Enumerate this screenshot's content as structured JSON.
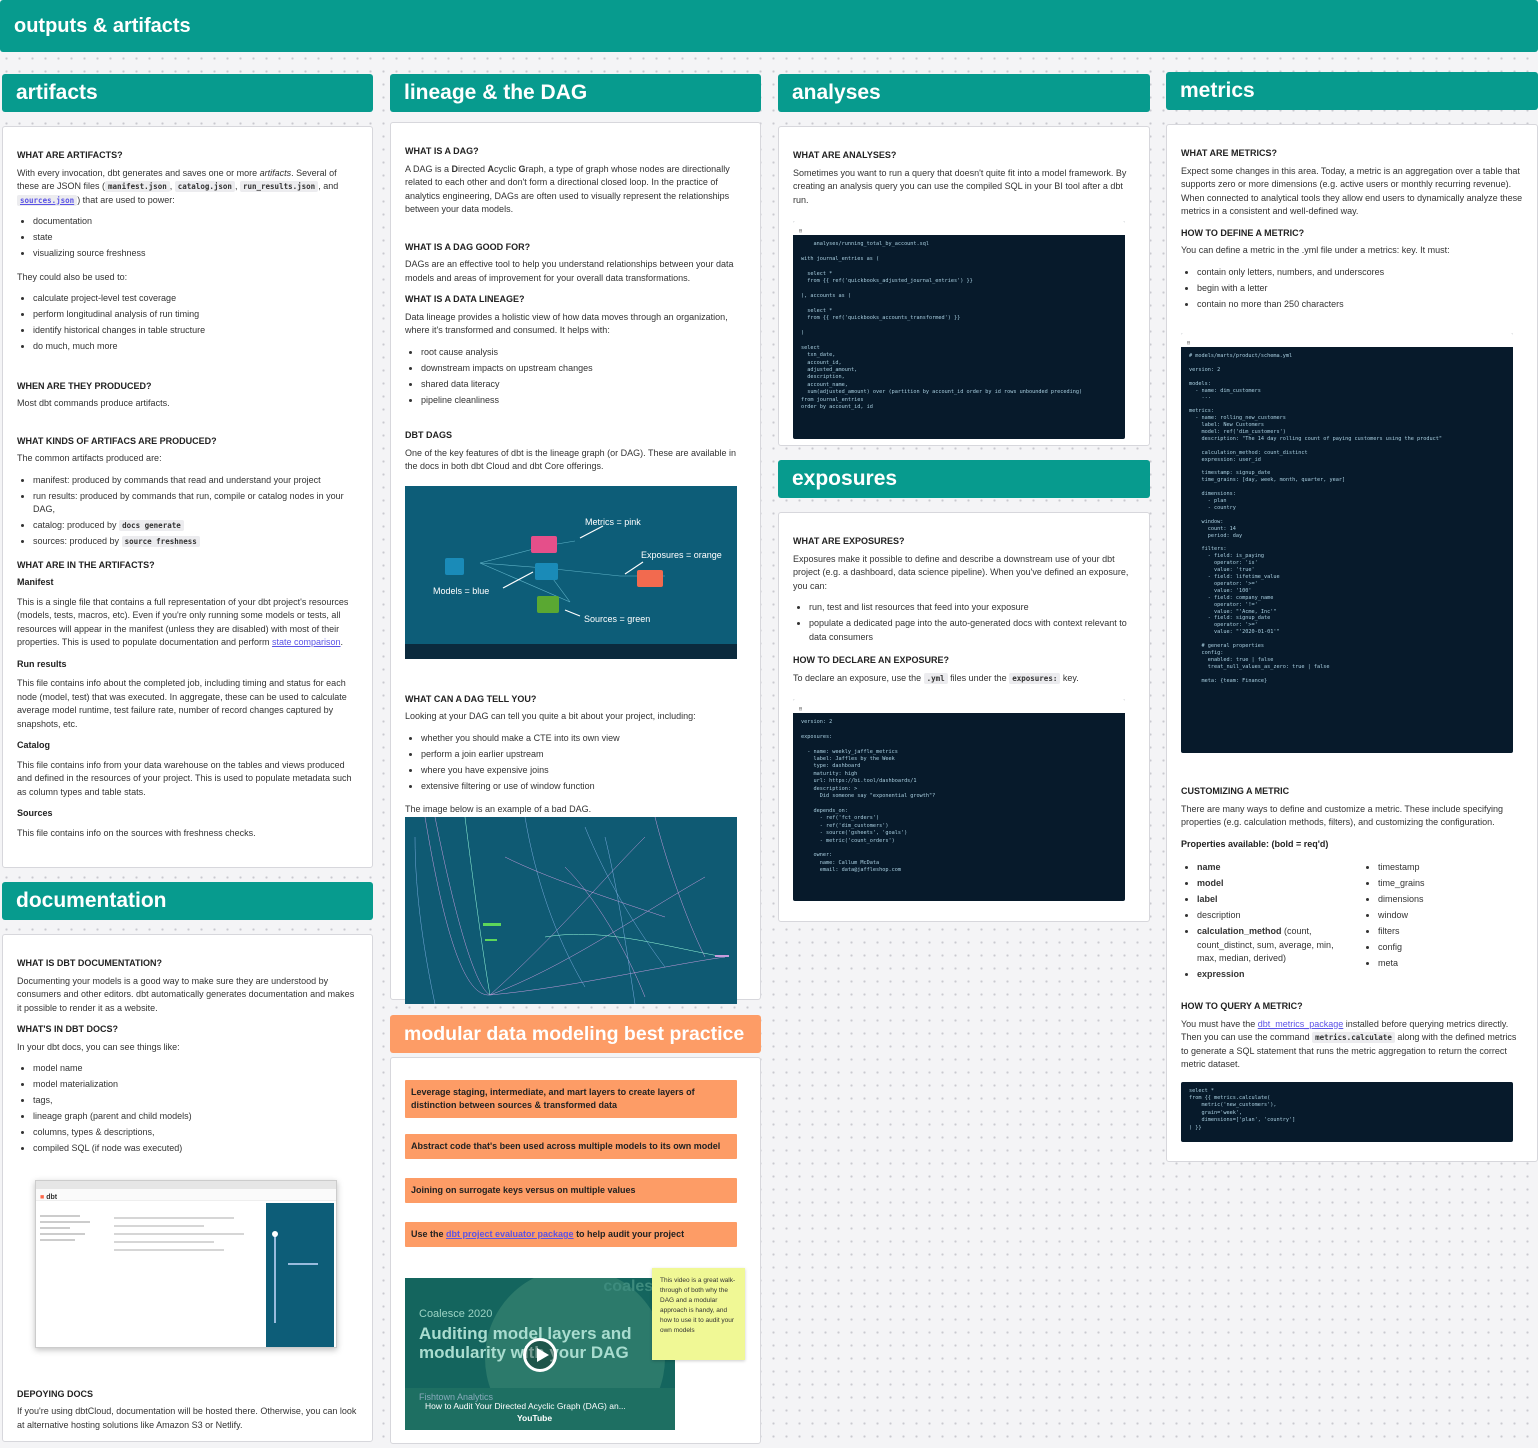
{
  "page": {
    "title": "outputs & artifacts"
  },
  "sections": {
    "artifacts": "artifacts",
    "lineage": "lineage & the DAG",
    "analyses": "analyses",
    "metrics": "metrics",
    "exposures": "exposures",
    "documentation": "documentation",
    "modular": "modular data modeling best practice"
  },
  "artifacts": {
    "q1": "WHAT ARE ARTIFACTS?",
    "p1_a": "With every invocation, dbt generates and saves one or more ",
    "p1_em": "artifacts",
    "p1_b": ". Several of these are JSON files (",
    "f1": "manifest.json",
    "f2": "catalog.json",
    "f3": "run_results.json",
    "f4": "sources.json",
    "p1_and": ", and ",
    "p1_c": ") that are used to power:",
    "sep": ", ",
    "list1": [
      "documentation",
      "state",
      "visualizing source freshness"
    ],
    "p2": "They could also be used to:",
    "list2": [
      "calculate project-level test coverage",
      "perform longitudinal analysis of run timing",
      "identify historical changes in table structure",
      "do much, much more"
    ],
    "q2": "WHEN ARE THEY PRODUCED?",
    "p3": "Most dbt commands produce artifacts.",
    "q3": "WHAT KINDS OF ARTIFACS ARE PRODUCED?",
    "p4": "The common artifacts produced are:",
    "k1": "manifest: produced by commands that read and understand your project",
    "k2": "run results: produced by commands that run, compile or catalog nodes in your DAG,",
    "k3a": "catalog: produced by ",
    "k3c": "docs generate",
    "k4a": "sources: produced by ",
    "k4c": "source freshness",
    "q4": "WHAT ARE IN THE ARTIFACTS?",
    "manifest_h": "Manifest",
    "manifest_p_a": "This is a single file that contains a full representation of your dbt project's resources (models, tests, macros, etc). Even if you're only running some models or tests, all resources will appear in the manifest (unless they are disabled) with most of their properties. This is used to populate documentation and perform ",
    "manifest_link": "state comparison",
    "manifest_p_b": ".",
    "run_h": "Run results",
    "run_p": "This file contains info about the completed job, including timing and status for each node (model, test) that was executed. In aggregate, these can be used to calculate average model runtime, test failure rate, number of record changes captured by snapshots, etc.",
    "catalog_h": "Catalog",
    "catalog_p": "This file contains info from your data warehouse on the tables and views produced and defined in the resources of your project. This is used to populate metadata such as column types and table stats.",
    "sources_h": "Sources",
    "sources_p": "This file contains info on the sources with freshness checks."
  },
  "documentation": {
    "q1": "WHAT IS DBT DOCUMENTATION?",
    "p1": "Documenting your models is a good way to make sure they are understood by consumers and other editors. dbt automatically generates documentation and makes it possible to render it as a website.",
    "q2": "WHAT'S IN DBT DOCS?",
    "p2": "In your dbt docs, you can see things like:",
    "list": [
      "model name",
      "model materialization",
      "tags,",
      "lineage graph (parent and child models)",
      "columns, types & descriptions,",
      "compiled SQL (if node was executed)"
    ],
    "logo": "dbt",
    "q3": "DEPOYING DOCS",
    "p3": "If you're using dbtCloud, documentation will be hosted there. Otherwise, you can look at alternative hosting solutions like Amazon S3 or Netlify."
  },
  "lineage": {
    "q1": "WHAT IS A DAG?",
    "p1_a": "A DAG is a ",
    "p1_D": "D",
    "p1_b": "irected ",
    "p1_A": "A",
    "p1_c": "cyclic ",
    "p1_G": "G",
    "p1_d": "raph, a type of graph whose nodes are directionally related to each other and don't form a directional closed loop. In the practice of analytics engineering, DAGs are often used to visually represent the relationships between your data models.",
    "q2": "WHAT IS A DAG GOOD FOR?",
    "p2": "DAGs are an effective tool to help you understand relationships between your data models and areas of improvement for your overall data transformations.",
    "q3": "WHAT IS A DATA LINEAGE?",
    "p3": "Data lineage provides a holistic view of how data moves through an organization, where it's transformed and consumed. It helps with:",
    "list1": [
      "root cause analysis",
      "downstream impacts on upstream changes",
      "shared data literacy",
      "pipeline cleanliness"
    ],
    "q4": "DBT DAGS",
    "p4": "One of the key features of dbt is the lineage graph (or DAG). These are available in the docs in both dbt Cloud and dbt Core offerings.",
    "dag_labels": {
      "metrics": "Metrics = pink",
      "exposures": "Exposures = orange",
      "models": "Models = blue",
      "sources": "Sources = green"
    },
    "q5": "WHAT CAN A DAG TELL YOU?",
    "p5": "Looking at your DAG can tell you quite a bit about your project, including:",
    "list2": [
      "whether you should make a CTE into its own view",
      "perform a join earlier upstream",
      "where you have expensive joins",
      "extensive filtering or use of window function"
    ],
    "p6": "The image below is an example of a bad DAG."
  },
  "modular": {
    "items": [
      "Leverage staging, intermediate, and mart layers to create layers of distinction between sources & transformed data",
      "Abstract code that's been used across multiple models to its own model",
      "Joining on surrogate keys versus on multiple values"
    ],
    "item4_a": "Use the ",
    "item4_link": "dbt project evaluator package",
    "item4_b": " to help audit your project",
    "video": {
      "year": "Coalesce 2020",
      "headline": "Auditing model layers and modularity with your DAG",
      "presenter": "Fishtown Analytics",
      "title": "How to Audit Your Directed Acyclic Graph (DAG) an...",
      "platform": "YouTube",
      "brand": "coalesce"
    },
    "sticky": "This video is a great walk-through of both why the DAG and a modular approach is handy, and how to use it to audit your own models"
  },
  "analyses": {
    "q1": "WHAT ARE ANALYSES?",
    "p1": "Sometimes you want to run a query that doesn't quite fit into a model framework. By creating an analysis query you can use the compiled SQL in your BI tool after a dbt run.",
    "code": "    analyses/running_total_by_account.sql\n\nwith journal_entries as (\n\n  select *\n  from {{ ref('quickbooks_adjusted_journal_entries') }}\n\n), accounts as (\n\n  select *\n  from {{ ref('quickbooks_accounts_transformed') }}\n\n)\n\nselect\n  txn_date,\n  account_id,\n  adjusted_amount,\n  description,\n  account_name,\n  sum(adjusted_amount) over (partition by account_id order by id rows unbounded preceding)\nfrom journal_entries\norder by account_id, id"
  },
  "exposures": {
    "q1": "WHAT ARE EXPOSURES?",
    "p1": "Exposures make it possible to define and describe a downstream use of your dbt project (e.g. a dashboard, data science pipeline). When you've defined an exposure, you can:",
    "list": [
      "run, test and list resources that feed into your exposure",
      "populate a dedicated page into the auto-generated docs with context relevant to data consumers"
    ],
    "q2": "HOW TO DECLARE AN EXPOSURE?",
    "p2_a": "To declare an exposure, use the ",
    "p2_c1": ".yml",
    "p2_b": " files under the ",
    "p2_c2": "exposures:",
    "p2_d": " key.",
    "code": "version: 2\n\nexposures:\n\n  - name: weekly_jaffle_metrics\n    label: Jaffles by the Week\n    type: dashboard\n    maturity: high\n    url: https://bi.tool/dashboards/1\n    description: >\n      Did someone say \"exponential growth\"?\n\n    depends_on:\n      - ref('fct_orders')\n      - ref('dim_customers')\n      - source('gsheets', 'goals')\n      - metric('count_orders')\n\n    owner:\n      name: Callum McData\n      email: data@jaffleshop.com"
  },
  "metrics": {
    "q1": "WHAT ARE METRICS?",
    "p1": "Expect some changes in this area. Today, a metric is an aggregation over a table that supports zero or more dimensions (e.g. active users or monthly recurring revenue). When connected to analytical tools they allow end users to dynamically analyze these metrics in a consistent and well-defined way.",
    "q2": "HOW TO DEFINE A METRIC?",
    "p2": "You can define a metric in the .yml file under a metrics: key. It must:",
    "list1": [
      "contain only letters, numbers, and underscores",
      "begin with a letter",
      "contain no more than 250 characters"
    ],
    "code": "# models/marts/product/schema.yml\n\nversion: 2\n\nmodels:\n  - name: dim_customers\n    ...\n\nmetrics:\n  - name: rolling_new_customers\n    label: New Customers\n    model: ref('dim_customers')\n    description: \"The 14 day rolling count of paying customers using the product\"\n\n    calculation_method: count_distinct\n    expression: user_id\n\n    timestamp: signup_date\n    time_grains: [day, week, month, quarter, year]\n\n    dimensions:\n      - plan\n      - country\n\n    window:\n      count: 14\n      period: day\n\n    filters:\n      - field: is_paying\n        operator: 'is'\n        value: 'true'\n      - field: lifetime_value\n        operator: '>='\n        value: '100'\n      - field: company_name\n        operator: '!='\n        value: \"'Acme, Inc'\"\n      - field: signup_date\n        operator: '>='\n        value: \"'2020-01-01'\"\n\n    # general properties\n    config:\n      enabled: true | false\n      treat_null_values_as_zero: true | false\n\n    meta: {team: Finance}",
    "q3": "CUSTOMIZING A METRIC",
    "p3": "There are many ways to define and customize a metric. These include specifying properties (e.g. calculation methods, filters), and customizing the configuration.",
    "props_h": "Properties available: (bold = req'd)",
    "props_left": [
      {
        "t": "name",
        "b": true
      },
      {
        "t": "model",
        "b": true
      },
      {
        "t": "label",
        "b": true
      },
      {
        "t": "description",
        "b": false
      }
    ],
    "calc_b": "calculation_method",
    "calc_r": " (count, count_distinct, sum, average, min, max, median, derived)",
    "expr": "expression",
    "props_right": [
      "timestamp",
      "time_grains",
      "dimensions",
      "window",
      "filters",
      "config",
      "meta"
    ],
    "q4": "HOW TO QUERY A METRIC?",
    "p4_a": "You must have the ",
    "p4_link": "dbt_metrics_package",
    "p4_b": " installed before querying metrics directly. Then you can use the command ",
    "p4_code": "metrics.calculate",
    "p4_c": " along with the defined metrics to generate a SQL statement that runs the metric aggregation to return the correct metric dataset.",
    "code2": "select *\nfrom {{ metrics.calculate(\n    metric('new_customers'),\n    grain='week',\n    dimensions=['plan', 'country']\n) }}"
  },
  "colors": {
    "teal": "#079b8e",
    "orange": "#fd9c66",
    "link": "#5b53e6",
    "code_bg": "#071a2b",
    "dag_bg": "#0d5d78"
  }
}
